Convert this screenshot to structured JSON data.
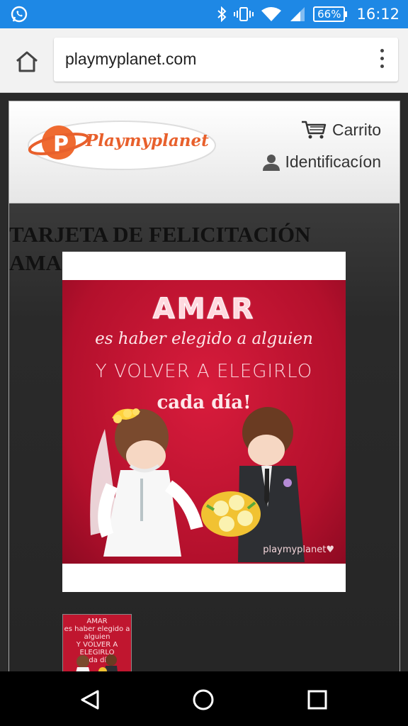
{
  "status_bar": {
    "battery": "66%",
    "time": "16:12",
    "icons": [
      "whatsapp-icon",
      "bluetooth-icon",
      "vibrate-icon",
      "wifi-icon",
      "cell-signal-icon"
    ]
  },
  "browser": {
    "url": "playmyplanet.com"
  },
  "site": {
    "logo_text": "Playmyplanet",
    "cart_label": "Carrito",
    "login_label": "Identificacíon"
  },
  "product": {
    "title": "TARJETA DE FELICITACIÓN\nAMA"
  },
  "card_image": {
    "line1": "AMAR",
    "line2": "es haber elegido a alguien",
    "line3": "Y VOLVER A ELEGIRLO",
    "line4": "cada día!",
    "brand": "playmyplanet♥"
  },
  "thumbnail": {
    "text": "AMAR\nes haber elegido a alguien\nY VOLVER A ELEGIRLO\ncada día!"
  },
  "colors": {
    "status_bar": "#1e88e5",
    "brand_orange": "#e8602c",
    "card_red": "#c8152f"
  }
}
